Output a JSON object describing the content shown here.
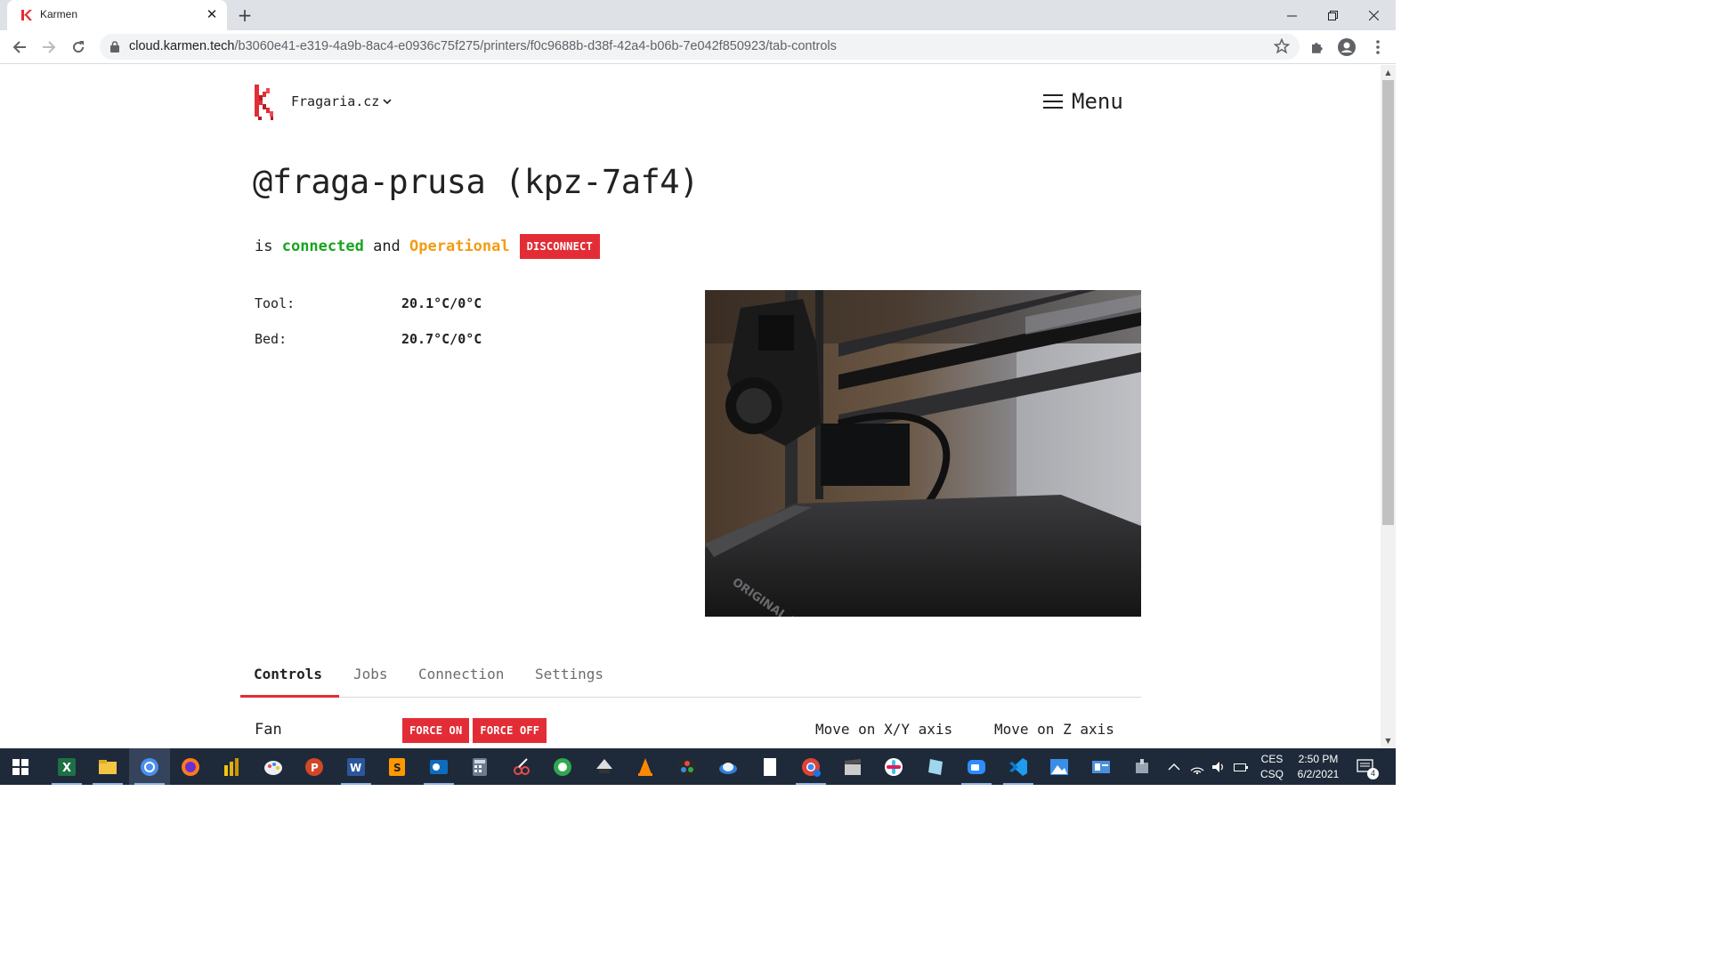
{
  "browser": {
    "tab_title": "Karmen",
    "url_host": "cloud.karmen.tech",
    "url_path": "/b3060e41-e319-4a9b-8ac4-e0936c75f275/printers/f0c9688b-d38f-42a4-b06b-7e042f850923/tab-controls"
  },
  "header": {
    "org_name": "Fragaria.cz",
    "menu_label": "Menu"
  },
  "printer": {
    "title": "@fraga-prusa (kpz-7af4)",
    "status_prefix": "is ",
    "status_connection": "connected",
    "status_joiner": " and ",
    "status_state": "Operational",
    "disconnect_label": "DISCONNECT"
  },
  "temperatures": [
    {
      "label": "Tool:",
      "value": "20.1°C/0°C"
    },
    {
      "label": "Bed:",
      "value": "20.7°C/0°C"
    }
  ],
  "webcam": {
    "print_bed_text": "ORIGINAL PRUSA"
  },
  "tabs": [
    {
      "label": "Controls",
      "active": true
    },
    {
      "label": "Jobs",
      "active": false
    },
    {
      "label": "Connection",
      "active": false
    },
    {
      "label": "Settings",
      "active": false
    }
  ],
  "controls": {
    "fan_label": "Fan",
    "force_on_label": "FORCE ON",
    "force_off_label": "FORCE OFF",
    "move_xy_label": "Move on X/Y axis",
    "move_z_label": "Move on Z axis"
  },
  "taskbar": {
    "language_line1": "CES",
    "language_line2": "CSQ",
    "time": "2:50 PM",
    "date": "6/2/2021",
    "notification_count": "4",
    "apps": [
      "windows-start",
      "excel",
      "file-explorer",
      "chrome",
      "firefox",
      "power-bi",
      "paint",
      "powerpoint",
      "word",
      "sublime-text",
      "outlook",
      "calculator",
      "snipping-tool",
      "greenshot",
      "inkscape",
      "vlc",
      "davinci-resolve",
      "onedrive",
      "notepad",
      "chrome-profile",
      "clapperboard",
      "slack",
      "paint-3d",
      "zoom",
      "vscode",
      "photos",
      "outlook-contact",
      "settings-gear"
    ]
  },
  "colors": {
    "accent_red": "#e32d36",
    "connected_green": "#18a51f",
    "operational_orange": "#f39c12"
  }
}
